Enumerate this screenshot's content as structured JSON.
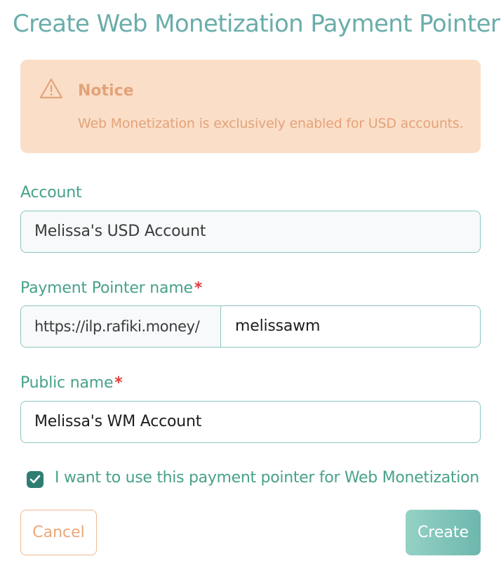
{
  "page": {
    "title": "Create Web Monetization Payment Pointer"
  },
  "notice": {
    "icon": "warning-triangle-icon",
    "title": "Notice",
    "message": "Web Monetization is exclusively enabled for USD accounts."
  },
  "form": {
    "account": {
      "label": "Account",
      "value": "Melissa's USD Account"
    },
    "payment_pointer": {
      "label": "Payment Pointer name",
      "required_marker": "*",
      "prefix": "https://ilp.rafiki.money/",
      "value": "melissawm"
    },
    "public_name": {
      "label": "Public name",
      "required_marker": "*",
      "value": "Melissa's WM Account"
    },
    "web_monetization_checkbox": {
      "label": "I want to use this payment pointer for Web Monetization",
      "checked": true
    }
  },
  "actions": {
    "cancel_label": "Cancel",
    "create_label": "Create"
  },
  "colors": {
    "title": "#6aadaa",
    "label": "#47a18a",
    "notice_bg": "#fbdec7",
    "notice_text": "#e2a37a",
    "border": "#8cc6c0",
    "required": "#e23c3c",
    "checkbox": "#2f7d72",
    "create_button": "#7cc2b7",
    "cancel_border": "#efb890"
  }
}
